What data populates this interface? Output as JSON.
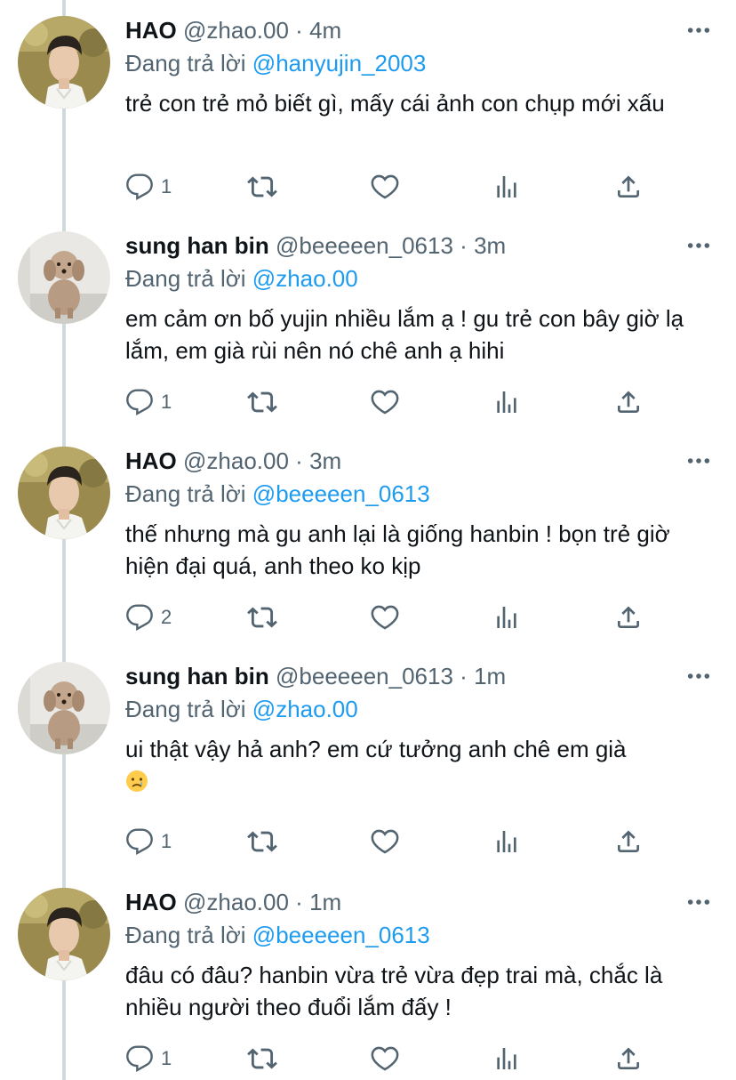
{
  "tweets": [
    {
      "name": "HAO",
      "handle": "@zhao.00",
      "time": "4m",
      "replying_label": "Đang trả lời",
      "replying_to": "@hanyujin_2003",
      "text": "trẻ con trẻ mỏ biết gì, mấy cái ảnh con chụp mới xấu",
      "reply_count": "1",
      "avatar": "boy-portrait"
    },
    {
      "name": "sung han bin",
      "handle": "@beeeeen_0613",
      "time": "3m",
      "replying_label": "Đang trả lời",
      "replying_to": "@zhao.00",
      "text": "em cảm ơn bố yujin nhiều lắm ạ ! gu trẻ con bây giờ lạ lắm, em già rùi nên nó chê anh ạ hihi",
      "reply_count": "1",
      "avatar": "poodle"
    },
    {
      "name": "HAO",
      "handle": "@zhao.00",
      "time": "3m",
      "replying_label": "Đang trả lời",
      "replying_to": "@beeeeen_0613",
      "text": "thế nhưng mà gu anh lại là giống hanbin ! bọn trẻ giờ hiện đại quá, anh theo ko kịp",
      "reply_count": "2",
      "avatar": "boy-portrait"
    },
    {
      "name": "sung han bin",
      "handle": "@beeeeen_0613",
      "time": "1m",
      "replying_label": "Đang trả lời",
      "replying_to": "@zhao.00",
      "text": "ui thật vậy hả anh? em cứ tưởng anh chê em già",
      "emoji": "crying-face",
      "reply_count": "1",
      "avatar": "poodle"
    },
    {
      "name": "HAO",
      "handle": "@zhao.00",
      "time": "1m",
      "replying_label": "Đang trả lời",
      "replying_to": "@beeeeen_0613",
      "text": "đâu có đâu? hanbin vừa trẻ vừa đẹp trai mà, chắc là nhiều người theo đuổi lắm đấy !",
      "reply_count": "1",
      "avatar": "boy-portrait"
    }
  ],
  "separator": "·",
  "colors": {
    "link": "#1d9bf0",
    "muted": "#536471",
    "text": "#0f1419",
    "thread_line": "#cfd9de"
  },
  "icons": [
    "reply-icon",
    "retweet-icon",
    "like-icon",
    "views-icon",
    "share-icon",
    "more-icon"
  ]
}
